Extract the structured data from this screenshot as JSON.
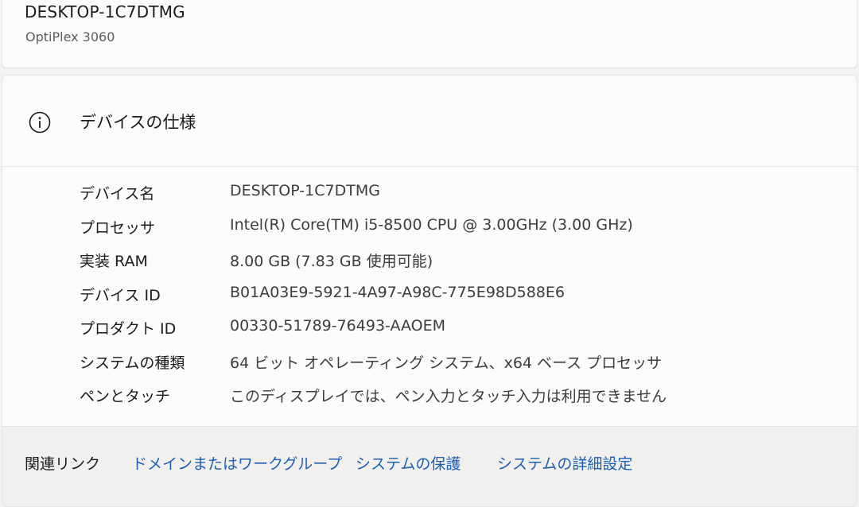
{
  "device": {
    "name": "DESKTOP-1C7DTMG",
    "model": "OptiPlex 3060"
  },
  "specs": {
    "title": "デバイスの仕様",
    "icon": "info-icon",
    "rows": [
      {
        "label": "デバイス名",
        "value": "DESKTOP-1C7DTMG"
      },
      {
        "label": "プロセッサ",
        "value": "Intel(R) Core(TM) i5-8500 CPU @ 3.00GHz (3.00 GHz)"
      },
      {
        "label": "実装 RAM",
        "value": "8.00 GB (7.83 GB 使用可能)"
      },
      {
        "label": "デバイス ID",
        "value": "B01A03E9-5921-4A97-A98C-775E98D588E6"
      },
      {
        "label": "プロダクト ID",
        "value": "00330-51789-76493-AAOEM"
      },
      {
        "label": "システムの種類",
        "value": "64 ビット オペレーティング システム、x64 ベース プロセッサ"
      },
      {
        "label": "ペンとタッチ",
        "value": "このディスプレイでは、ペン入力とタッチ入力は利用できません"
      }
    ]
  },
  "related": {
    "label": "関連リンク",
    "links": [
      "ドメインまたはワークグループ",
      "システムの保護",
      "システムの詳細設定"
    ]
  },
  "colors": {
    "link": "#1a5fb4",
    "card_background": "#fbfbfb",
    "related_background": "#f2f0ee"
  }
}
